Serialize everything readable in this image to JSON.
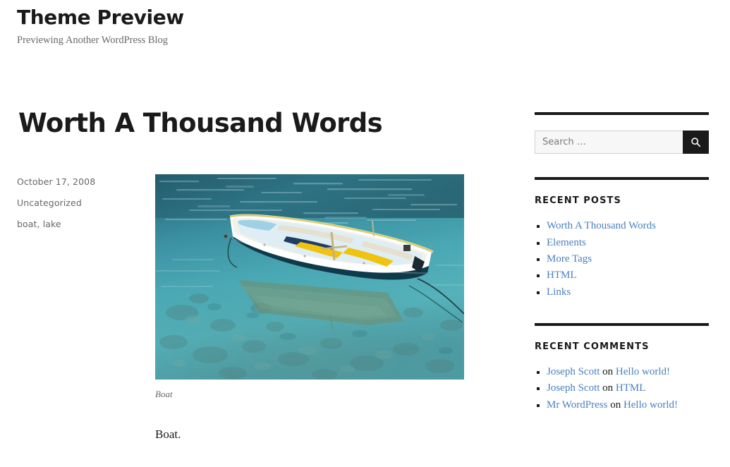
{
  "site": {
    "title": "Theme Preview",
    "description": "Previewing Another WordPress Blog"
  },
  "post": {
    "title": "Worth A Thousand Words",
    "date": "October 17, 2008",
    "category": "Uncategorized",
    "tags": "boat, lake",
    "image_alt": "Boat",
    "caption": "Boat",
    "paragraph": "Boat."
  },
  "sidebar": {
    "search": {
      "placeholder": "Search …",
      "value": "",
      "button_icon": "search-icon"
    },
    "recent_posts": {
      "title": "Recent Posts",
      "items": [
        {
          "label": "Worth A Thousand Words"
        },
        {
          "label": "Elements"
        },
        {
          "label": "More Tags"
        },
        {
          "label": "HTML"
        },
        {
          "label": "Links"
        }
      ]
    },
    "recent_comments": {
      "title": "Recent Comments",
      "separator": " on ",
      "items": [
        {
          "author": "Joseph Scott",
          "post": "Hello world!"
        },
        {
          "author": "Joseph Scott",
          "post": "HTML"
        },
        {
          "author": "Mr WordPress",
          "post": "Hello world!"
        }
      ]
    }
  },
  "colors": {
    "link": "#4b7fbf",
    "text": "#1a1a1a",
    "muted": "#686868",
    "bar": "#1a1a1a",
    "input_bg": "#f7f7f7"
  }
}
